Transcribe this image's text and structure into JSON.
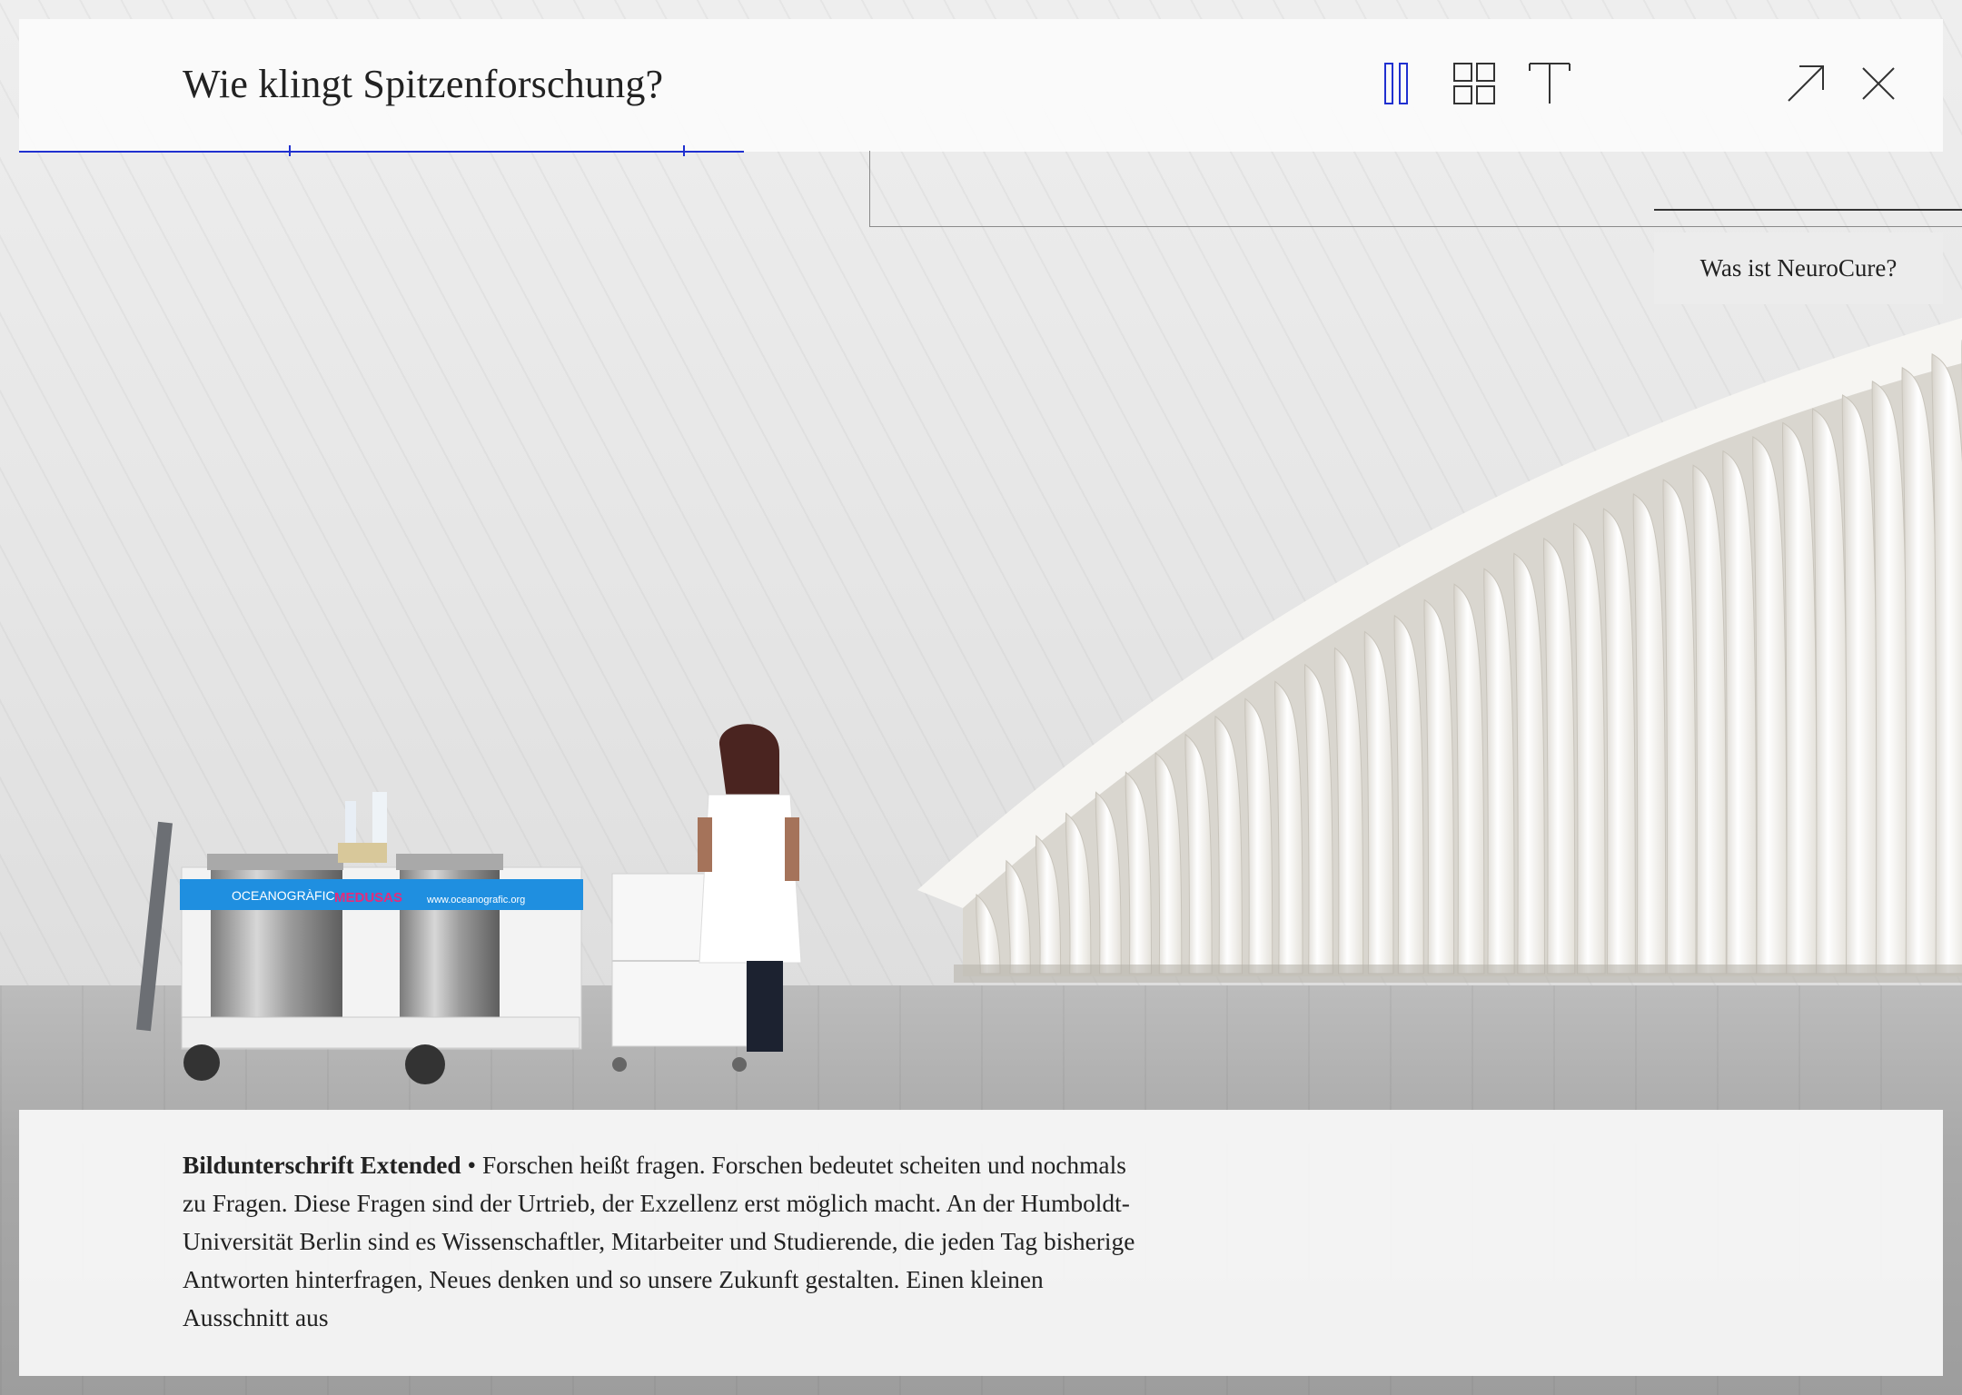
{
  "header": {
    "title": "Wie klingt Spitzenforschung?",
    "icons": [
      "pause-icon",
      "grid-view-icon",
      "text-view-icon",
      "expand-icon",
      "close-icon"
    ],
    "accent_color": "#2030d0"
  },
  "nav": {
    "next_label": "Was ist NeuroCure?"
  },
  "caption": {
    "heading": "Bildunterschrift Extended",
    "separator": "•",
    "body": "Forschen heißt fragen. Forschen bedeutet scheiten und nochmals zu Fragen. Diese Fragen sind der Urtrieb, der Exzellenz erst möglich macht. An der Humboldt-Universität Berlin sind es Wissenschaftler, Mitarbeiter und Studierende, die jeden Tag bisherige Antworten hinterfragen, Neues denken und so unsere Zukunft gestalten. Einen kleinen Ausschnitt aus"
  },
  "photo": {
    "cart_banner_brand": "OCEANOGRÀFIC",
    "cart_banner_sub": "VALÈNCIA",
    "cart_banner_title": "MEDUSAS",
    "cart_banner_url": "www.oceanografic.org"
  }
}
